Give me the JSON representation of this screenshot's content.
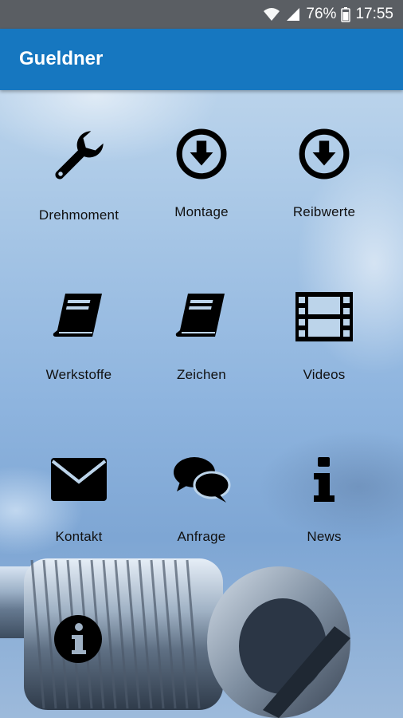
{
  "status_bar": {
    "battery": "76%",
    "time": "17:55"
  },
  "app_bar": {
    "title": "Gueldner"
  },
  "menu": [
    {
      "label": "Drehmoment",
      "icon": "wrench-icon"
    },
    {
      "label": "Montage",
      "icon": "download-circle-icon"
    },
    {
      "label": "Reibwerte",
      "icon": "download-circle-icon"
    },
    {
      "label": "Werkstoffe",
      "icon": "book-icon"
    },
    {
      "label": "Zeichen",
      "icon": "book-icon"
    },
    {
      "label": "Videos",
      "icon": "film-icon"
    },
    {
      "label": "Kontakt",
      "icon": "envelope-icon"
    },
    {
      "label": "Anfrage",
      "icon": "chat-bubbles-icon"
    },
    {
      "label": "News",
      "icon": "info-icon"
    }
  ],
  "extra_button": {
    "icon": "info-circle-icon"
  }
}
